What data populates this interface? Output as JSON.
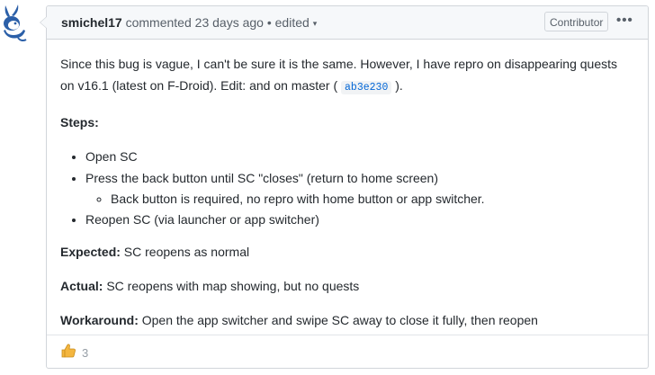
{
  "comment": {
    "author": "smichel17",
    "action": "commented",
    "time": "23 days ago",
    "separator": "•",
    "edited": "edited",
    "caret": "▾",
    "role_badge": "Contributor",
    "menu_icon": "•••",
    "body": {
      "p1_text": "Since this bug is vague, I can't be sure it is the same. However, I have repro on disappearing quests on v16.1 (latest on F-Droid). Edit: and on master (",
      "p1_code": "ab3e230",
      "p1_end": ").",
      "steps_heading": "Steps:",
      "steps": [
        "Open SC",
        "Press the back button until SC \"closes\" (return to home screen)",
        "Reopen SC (via launcher or app switcher)"
      ],
      "substep": "Back button is required, no repro with home button or app switcher.",
      "expected_label": "Expected:",
      "expected_text": " SC reopens as normal",
      "actual_label": "Actual:",
      "actual_text": " SC reopens with map showing, but no quests",
      "workaround_label": "Workaround:",
      "workaround_text": " Open the app switcher and swipe SC away to close it fully, then reopen"
    },
    "reaction": {
      "icon": "thumbs-up-icon",
      "count": "3"
    }
  }
}
